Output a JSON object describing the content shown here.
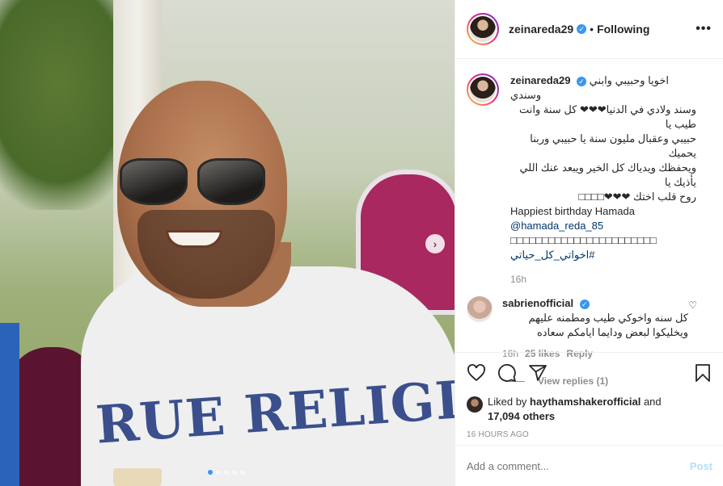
{
  "post": {
    "author": "zeinareda29",
    "follow_status": "Following",
    "separator": "•",
    "more": "•••"
  },
  "caption": {
    "author": "zeinareda29",
    "lines_rtl": [
      "اخويا وحبيبي وابني وسندي",
      "وسند ولادي في الدنيا❤❤❤ كل سنة وانت طيب يا",
      "حبيبي وعقبال مليون سنة يا حبيبي وربنا يحميك",
      "ويحفظك ويدياك كل الخير ويبعد عنك اللي يأذيك يا",
      "روح قلب اختك ❤❤❤□□□□"
    ],
    "english": "Happiest birthday Hamada",
    "mention": "@hamada_reda_85",
    "mention_tail": " □□□□□□□□□□□□□□□□□□□□□□□",
    "hashtag": "#اخواتي_كل_حياتي",
    "time": "16h"
  },
  "comment": {
    "author": "sabrienofficial",
    "text_rtl": "كل سنه واخوكي طيب ومطمنه عليهم ويخليكوا لبعض ودايما ايامكم سعاده",
    "time": "16h",
    "likes": "25 likes",
    "reply": "Reply",
    "view_replies": "View replies (1)"
  },
  "likes": {
    "prefix": "Liked by ",
    "liker": "haythamshakerofficial",
    "middle": " and",
    "count": "17,094 others"
  },
  "posted_ago": "16 HOURS AGO",
  "add_comment": {
    "placeholder": "Add a comment...",
    "post_label": "Post"
  },
  "carousel": {
    "next": "›",
    "slides": 5,
    "active_index": 0
  },
  "image_text": "RUE RELIGION",
  "colors": {
    "accent": "#3897f0",
    "link": "#00376b",
    "muted": "#8e8e8e",
    "post_disabled": "#b2dffc"
  },
  "icons": {
    "like": "heart-icon",
    "comment": "comment-icon",
    "share": "share-icon",
    "save": "bookmark-icon"
  }
}
